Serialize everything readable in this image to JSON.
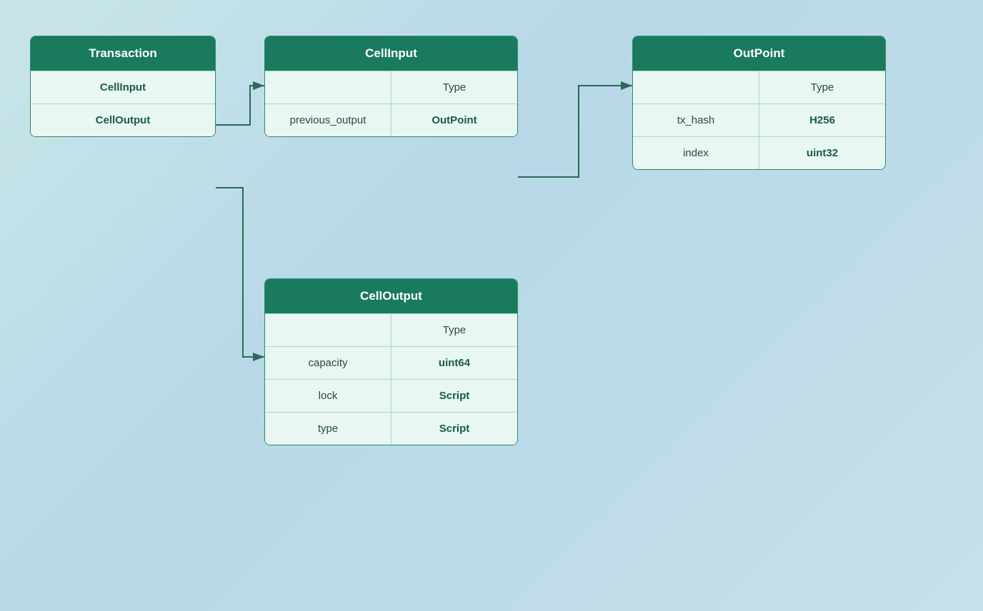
{
  "transaction": {
    "title": "Transaction",
    "rows": [
      {
        "name": "CellInput",
        "type": null
      },
      {
        "name": "CellOutput",
        "type": null
      }
    ]
  },
  "cellinput": {
    "title": "CellInput",
    "rows": [
      {
        "name": "",
        "type": "Type"
      },
      {
        "name": "previous_output",
        "type": "OutPoint"
      }
    ]
  },
  "outpoint": {
    "title": "OutPoint",
    "rows": [
      {
        "name": "",
        "type": "Type"
      },
      {
        "name": "tx_hash",
        "type": "H256"
      },
      {
        "name": "index",
        "type": "uint32"
      }
    ]
  },
  "celloutput": {
    "title": "CellOutput",
    "rows": [
      {
        "name": "",
        "type": "Type"
      },
      {
        "name": "capacity",
        "type": "uint64"
      },
      {
        "name": "lock",
        "type": "Script"
      },
      {
        "name": "type",
        "type": "Script"
      }
    ]
  },
  "colors": {
    "header_bg": "#1a7a5e",
    "row_bg": "#e8f7f2",
    "border": "#a8d8c8",
    "arrow": "#2a6a54"
  }
}
